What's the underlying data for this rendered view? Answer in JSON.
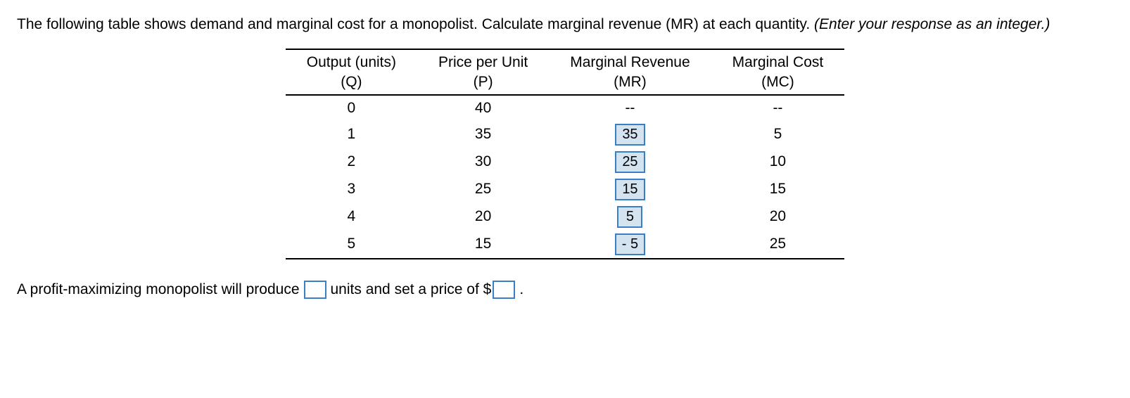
{
  "question": {
    "main": "The following table shows demand and marginal cost for a monopolist. Calculate marginal revenue (MR) at each quantity. ",
    "hint": "(Enter your response as an integer.)"
  },
  "table": {
    "headers": {
      "q": {
        "line1": "Output (units)",
        "line2": "(Q)"
      },
      "p": {
        "line1": "Price per Unit",
        "line2": "(P)"
      },
      "mr": {
        "line1": "Marginal Revenue",
        "line2": "(MR)"
      },
      "mc": {
        "line1": "Marginal Cost",
        "line2": "(MC)"
      }
    },
    "rows": [
      {
        "q": "0",
        "p": "40",
        "mr": "--",
        "mc": "--",
        "mr_input": false
      },
      {
        "q": "1",
        "p": "35",
        "mr": "35",
        "mc": "5",
        "mr_input": true
      },
      {
        "q": "2",
        "p": "30",
        "mr": "25",
        "mc": "10",
        "mr_input": true
      },
      {
        "q": "3",
        "p": "25",
        "mr": "15",
        "mc": "15",
        "mr_input": true
      },
      {
        "q": "4",
        "p": "20",
        "mr": "5",
        "mc": "20",
        "mr_input": true
      },
      {
        "q": "5",
        "p": "15",
        "mr": "- 5",
        "mc": "25",
        "mr_input": true
      }
    ]
  },
  "answer": {
    "part1": "A profit-maximizing monopolist will produce",
    "part2": "units and set a price of $",
    "part3": "."
  }
}
